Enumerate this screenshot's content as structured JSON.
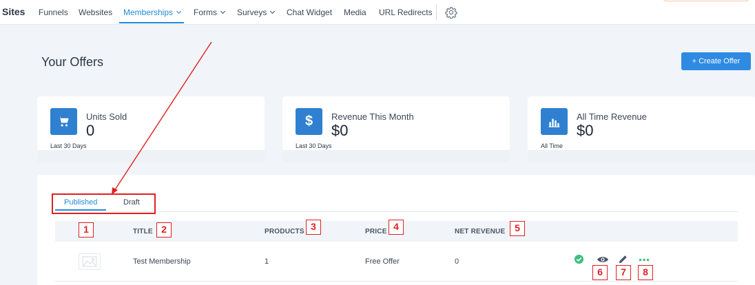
{
  "nav": {
    "brand": "Sites",
    "items": [
      {
        "label": "Funnels"
      },
      {
        "label": "Websites"
      },
      {
        "label": "Memberships"
      },
      {
        "label": "Forms"
      },
      {
        "label": "Surveys"
      },
      {
        "label": "Chat Widget"
      },
      {
        "label": "Media"
      },
      {
        "label": "URL Redirects"
      }
    ],
    "settings_icon": "gear-icon",
    "accent_color": "#1f8bd9"
  },
  "page": {
    "title": "Your Offers",
    "create_button": "+ Create Offer"
  },
  "stats": [
    {
      "label": "Units Sold",
      "value": "0",
      "sub": "Last 30 Days",
      "icon": "cart-icon"
    },
    {
      "label": "Revenue This Month",
      "value": "$0",
      "sub": "Last 30 Days",
      "icon": "dollar-icon"
    },
    {
      "label": "All Time Revenue",
      "value": "$0",
      "sub": "All Time",
      "icon": "bar-chart-icon"
    }
  ],
  "tabs": [
    {
      "label": "Published"
    },
    {
      "label": "Draft"
    }
  ],
  "table": {
    "columns": [
      "TITLE",
      "PRODUCTS",
      "PRICE",
      "NET REVENUE"
    ],
    "rows": [
      {
        "title": "Test Membership",
        "products": "1",
        "price": "Free Offer",
        "net_revenue": "0"
      }
    ]
  },
  "annotations": {
    "numbers": [
      "1",
      "2",
      "3",
      "4",
      "5",
      "6",
      "7",
      "8"
    ],
    "color": "#e02020"
  }
}
